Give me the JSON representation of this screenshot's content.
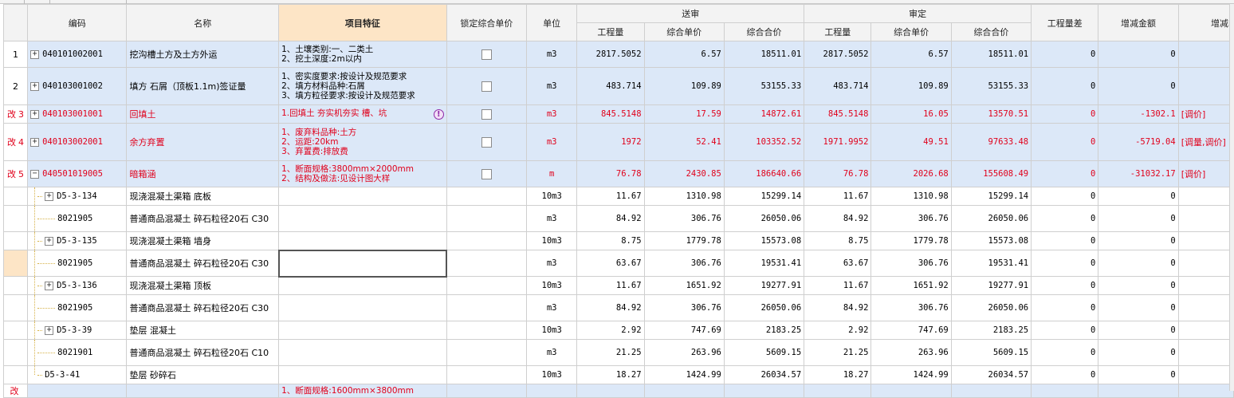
{
  "headers": {
    "code": "编码",
    "name": "名称",
    "feature": "项目特征",
    "lock": "锁定综合单价",
    "unit": "单位",
    "submit_group": "送审",
    "approve_group": "审定",
    "qty": "工程量",
    "unit_price": "综合单价",
    "total_price": "综合合价",
    "qty_diff": "工程量差",
    "amount_change": "增减金额",
    "change_note": "增减i"
  },
  "rows": [
    {
      "type": "bill",
      "idx": "1",
      "mod": "",
      "expand": "+",
      "code": "040101002001",
      "name": "挖沟槽土方及土方外运",
      "feature": [
        "1、土壤类别:一、二类土",
        "2、挖土深度:2m以内"
      ],
      "unit": "m3",
      "s_qty": "2817.5052",
      "s_price": "6.57",
      "s_total": "18511.01",
      "a_qty": "2817.5052",
      "a_price": "6.57",
      "a_total": "18511.01",
      "diff": "0",
      "change": "0",
      "note": ""
    },
    {
      "type": "bill",
      "idx": "2",
      "mod": "",
      "expand": "+",
      "code": "040103001002",
      "name": "填方 石屑（顶板1.1m)签证量",
      "feature": [
        "1、密实度要求:按设计及规范要求",
        "2、填方材料品种:石屑",
        "3、填方粒径要求:按设计及规范要求"
      ],
      "unit": "m3",
      "s_qty": "483.714",
      "s_price": "109.89",
      "s_total": "53155.33",
      "a_qty": "483.714",
      "a_price": "109.89",
      "a_total": "53155.33",
      "diff": "0",
      "change": "0",
      "note": ""
    },
    {
      "type": "bill",
      "idx": "3",
      "mod": "改",
      "expand": "+",
      "code": "040103001001",
      "name": "回填土",
      "feature": [
        "1.回填土 夯实机夯实 槽、坑"
      ],
      "warn": "!",
      "unit": "m3",
      "s_qty": "845.5148",
      "s_price": "17.59",
      "s_total": "14872.61",
      "a_qty": "845.5148",
      "a_price": "16.05",
      "a_total": "13570.51",
      "diff": "0",
      "change": "-1302.1",
      "note": "[调价]"
    },
    {
      "type": "bill",
      "idx": "4",
      "mod": "改",
      "expand": "+",
      "code": "040103002001",
      "name": "余方弃置",
      "feature": [
        "1、废弃料品种:土方",
        "2、运距:20km",
        "3、弃置费:排放费"
      ],
      "unit": "m3",
      "s_qty": "1972",
      "s_price": "52.41",
      "s_total": "103352.52",
      "a_qty": "1971.9952",
      "a_price": "49.51",
      "a_total": "97633.48",
      "diff": "0",
      "change": "-5719.04",
      "note": "[调量,调价]"
    },
    {
      "type": "bill",
      "idx": "5",
      "mod": "改",
      "expand": "−",
      "code": "040501019005",
      "name": "暗箱涵",
      "feature": [
        "1、断面规格:3800mm×2000mm",
        "2、结构及做法:见设计图大样"
      ],
      "unit": "m",
      "s_qty": "76.78",
      "s_price": "2430.85",
      "s_total": "186640.66",
      "a_qty": "76.78",
      "a_price": "2026.68",
      "a_total": "155608.49",
      "diff": "0",
      "change": "-31032.17",
      "note": "[调价]"
    },
    {
      "type": "sub",
      "idx": "",
      "expand": "+",
      "level": "quota",
      "code": "D5-3-134",
      "name": "现浇混凝土渠箱 底板",
      "feature": [],
      "unit": "10m3",
      "s_qty": "11.67",
      "s_price": "1310.98",
      "s_total": "15299.14",
      "a_qty": "11.67",
      "a_price": "1310.98",
      "a_total": "15299.14",
      "diff": "0",
      "change": "0",
      "note": ""
    },
    {
      "type": "sub",
      "idx": "",
      "expand": "",
      "level": "material",
      "code": "8021905",
      "name": "普通商品混凝土 碎石粒径20石 C30",
      "feature": [],
      "unit": "m3",
      "s_qty": "84.92",
      "s_price": "306.76",
      "s_total": "26050.06",
      "a_qty": "84.92",
      "a_price": "306.76",
      "a_total": "26050.06",
      "diff": "0",
      "change": "0",
      "note": ""
    },
    {
      "type": "sub",
      "idx": "",
      "expand": "+",
      "level": "quota",
      "code": "D5-3-135",
      "name": "现浇混凝土渠箱 墙身",
      "feature": [],
      "unit": "10m3",
      "s_qty": "8.75",
      "s_price": "1779.78",
      "s_total": "15573.08",
      "a_qty": "8.75",
      "a_price": "1779.78",
      "a_total": "15573.08",
      "diff": "0",
      "change": "0",
      "note": ""
    },
    {
      "type": "sub",
      "idx": "",
      "expand": "",
      "level": "material",
      "selected": true,
      "code": "8021905",
      "name": "普通商品混凝土 碎石粒径20石 C30",
      "feature": [],
      "unit": "m3",
      "s_qty": "63.67",
      "s_price": "306.76",
      "s_total": "19531.41",
      "a_qty": "63.67",
      "a_price": "306.76",
      "a_total": "19531.41",
      "diff": "0",
      "change": "0",
      "note": ""
    },
    {
      "type": "sub",
      "idx": "",
      "expand": "+",
      "level": "quota",
      "code": "D5-3-136",
      "name": "现浇混凝土渠箱 顶板",
      "feature": [],
      "unit": "10m3",
      "s_qty": "11.67",
      "s_price": "1651.92",
      "s_total": "19277.91",
      "a_qty": "11.67",
      "a_price": "1651.92",
      "a_total": "19277.91",
      "diff": "0",
      "change": "0",
      "note": ""
    },
    {
      "type": "sub",
      "idx": "",
      "expand": "",
      "level": "material",
      "code": "8021905",
      "name": "普通商品混凝土 碎石粒径20石 C30",
      "feature": [],
      "unit": "m3",
      "s_qty": "84.92",
      "s_price": "306.76",
      "s_total": "26050.06",
      "a_qty": "84.92",
      "a_price": "306.76",
      "a_total": "26050.06",
      "diff": "0",
      "change": "0",
      "note": ""
    },
    {
      "type": "sub",
      "idx": "",
      "expand": "+",
      "level": "quota",
      "code": "D5-3-39",
      "name": "垫层 混凝土",
      "feature": [],
      "unit": "10m3",
      "s_qty": "2.92",
      "s_price": "747.69",
      "s_total": "2183.25",
      "a_qty": "2.92",
      "a_price": "747.69",
      "a_total": "2183.25",
      "diff": "0",
      "change": "0",
      "note": ""
    },
    {
      "type": "sub",
      "idx": "",
      "expand": "",
      "level": "material",
      "code": "8021901",
      "name": "普通商品混凝土 碎石粒径20石 C10",
      "feature": [],
      "unit": "m3",
      "s_qty": "21.25",
      "s_price": "263.96",
      "s_total": "5609.15",
      "a_qty": "21.25",
      "a_price": "263.96",
      "a_total": "5609.15",
      "diff": "0",
      "change": "0",
      "note": ""
    },
    {
      "type": "sub",
      "idx": "",
      "expand": "",
      "level": "quota-last",
      "code": "D5-3-41",
      "name": "垫层 砂碎石",
      "feature": [],
      "unit": "10m3",
      "s_qty": "18.27",
      "s_price": "1424.99",
      "s_total": "26034.57",
      "a_qty": "18.27",
      "a_price": "1424.99",
      "a_total": "26034.57",
      "diff": "0",
      "change": "0",
      "note": ""
    },
    {
      "type": "bill-partial",
      "idx": "",
      "mod": "改",
      "code": "",
      "name": "",
      "feature": [
        "1、断面规格:1600mm×3800mm"
      ],
      "unit": "",
      "s_qty": "",
      "s_price": "",
      "s_total": "",
      "a_qty": "",
      "a_price": "",
      "a_total": "",
      "diff": "",
      "change": "",
      "note": ""
    }
  ],
  "colors": {
    "bill_bg": "#dce8f8",
    "modified_text": "#e0001b",
    "feature_header_bg": "#fde5c6",
    "header_bg": "#f3f3f3"
  },
  "icons": [
    "expand-icon",
    "collapse-icon",
    "checkbox-icon",
    "warning-icon"
  ]
}
